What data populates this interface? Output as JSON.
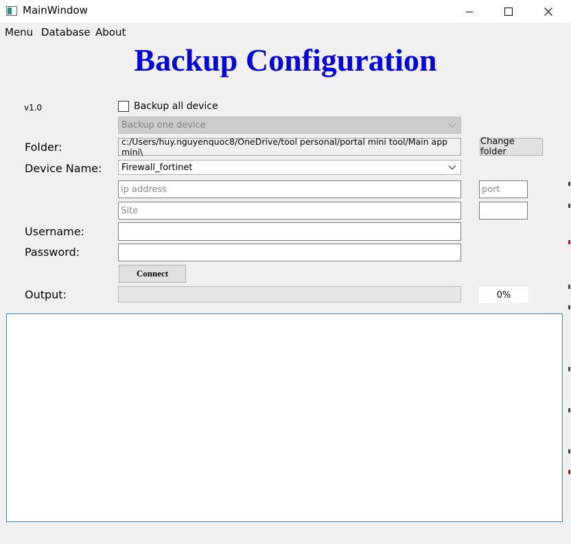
{
  "window": {
    "title": "MainWindow"
  },
  "menu": [
    "Menu",
    "Database",
    "About"
  ],
  "heading": "Backup Configuration",
  "version": "v1.0",
  "backup_all": {
    "label": "Backup all device",
    "checked": false
  },
  "backup_one": {
    "value": "Backup one device",
    "disabled": true
  },
  "folder": {
    "label": "Folder:",
    "path": "c:/Users/huy.nguyenquoc8/OneDrive/tool personal/portal mini tool/Main app mini\\",
    "change_button": "Change folder"
  },
  "device": {
    "label": "Device Name:",
    "selected": "Firewall_fortinet"
  },
  "ip_field": {
    "placeholder": "ip address"
  },
  "port_field": {
    "placeholder": "port"
  },
  "site_field": {
    "placeholder": "Site"
  },
  "username": {
    "label": "Username:",
    "value": ""
  },
  "password": {
    "label": "Password:",
    "value": ""
  },
  "connect_button": "Connect",
  "output": {
    "label": "Output:",
    "progress": 0,
    "percent_text": "0%",
    "text": ""
  }
}
